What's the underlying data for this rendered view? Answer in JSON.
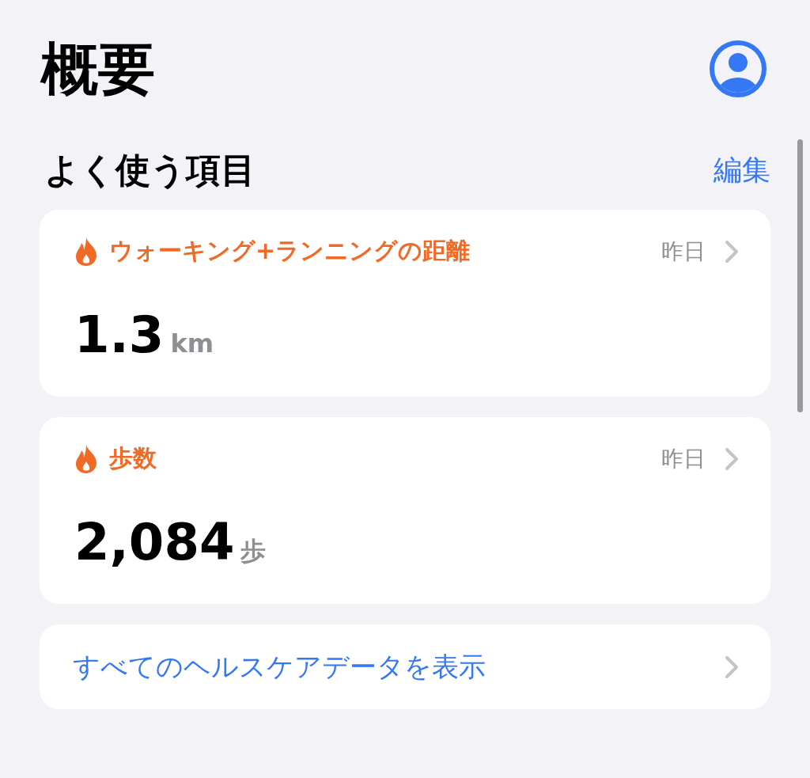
{
  "header": {
    "title": "概要"
  },
  "favorites": {
    "title": "よく使う項目",
    "edit": "編集",
    "cards": [
      {
        "kind": "metric",
        "label": "ウォーキング+ランニングの距離",
        "date": "昨日",
        "value": "1.3",
        "unit": "km"
      },
      {
        "kind": "metric",
        "label": "歩数",
        "date": "昨日",
        "value": "2,084",
        "unit": "歩"
      }
    ]
  },
  "show_all": {
    "label": "すべてのヘルスケアデータを表示"
  }
}
